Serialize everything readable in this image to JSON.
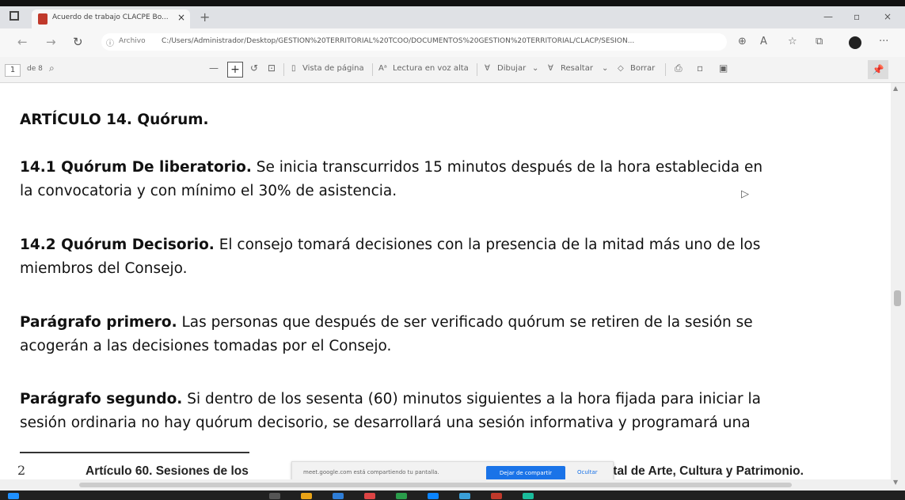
{
  "browser": {
    "tab_title": "Acuerdo de trabajo CLACPE Bo...",
    "tab_close": "×",
    "new_tab": "+",
    "url_scheme": "Archivo",
    "url_path": "C:/Users/Administrador/Desktop/GESTIÓN%20TERRITORIAL%20TCOO/DOCUMENTOS%20GESTIÓN%20TERRITORIAL/CLACP/SESIÓN...",
    "win_minimize": "—",
    "win_maximize": "▫",
    "win_close": "×",
    "more_menu": "···"
  },
  "pdf_toolbar": {
    "page_current": "1",
    "page_total": "de 8",
    "zoom_out": "—",
    "zoom_in": "+",
    "page_view": "Vista de página",
    "read_aloud": "Lectura en voz alta",
    "draw": "Dibujar",
    "highlight": "Resaltar",
    "erase": "Borrar"
  },
  "document": {
    "heading": "ARTÍCULO 14. Quórum.",
    "p1_bold": "14.1 Quórum De liberatorio.",
    "p1_line1": " Se inicia transcurridos 15 minutos después de la hora establecida en",
    "p1_line2": "la convocatoria y con mínimo el 30% de asistencia.",
    "p2_bold": "14.2 Quórum Decisorio.",
    "p2_line1": "  El consejo tomará decisiones con la presencia de la mitad más uno de los",
    "p2_line2": "miembros del Consejo.",
    "p3_bold": "Parágrafo primero.",
    "p3_line1": " Las personas que después de ser verificado quórum se retiren de la sesión se",
    "p3_line2": "acogerán a las decisiones tomadas por el Consejo.",
    "p4_bold": "Parágrafo segundo.",
    "p4_line1": " Si dentro de los sesenta (60) minutos siguientes a la hora fijada para iniciar la",
    "p4_line2": "sesión ordinaria no hay quórum decisorio, se desarrollará una sesión informativa y programará una",
    "footnote_number": "2",
    "footnote_left": "Artículo 60. Sesiones de los",
    "footnote_right": "ital de Arte, Cultura y Patrimonio."
  },
  "share_banner": {
    "text": "meet.google.com está compartiendo tu pantalla.",
    "stop_button": "Dejar de compartir",
    "hide_button": "Ocultar"
  }
}
